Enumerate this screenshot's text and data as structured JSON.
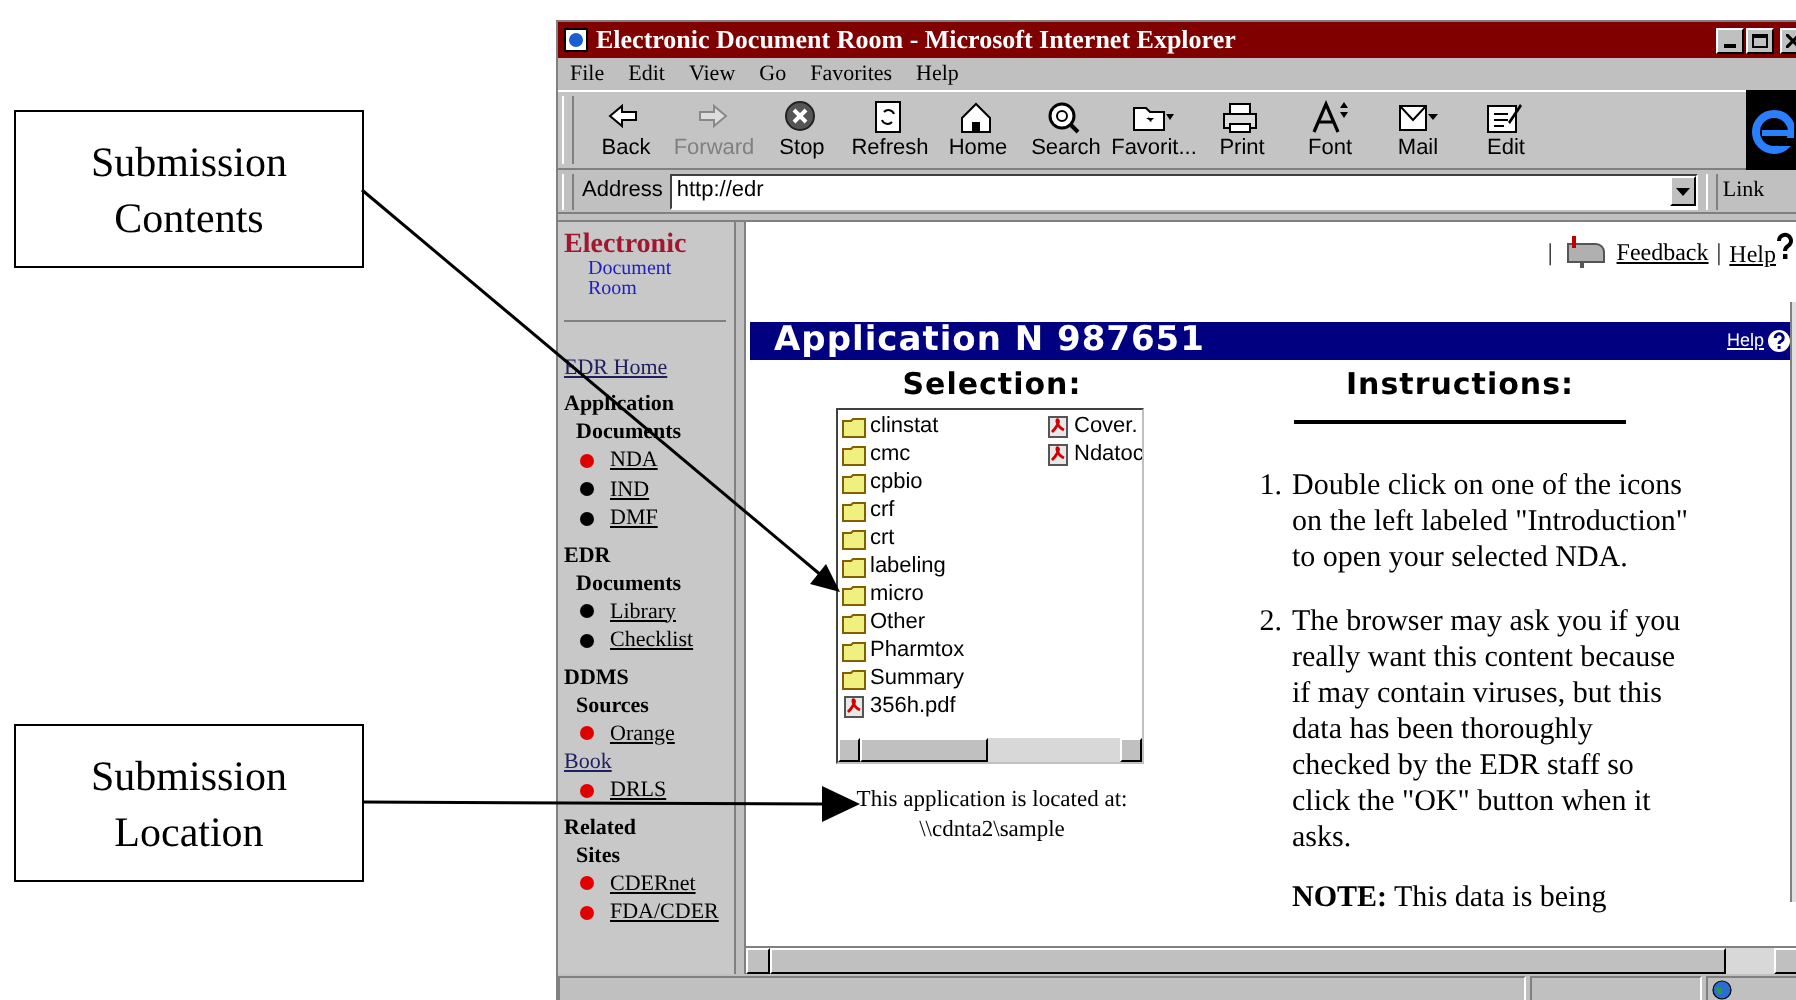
{
  "callouts": [
    {
      "lines": [
        "Submission",
        "Contents"
      ]
    },
    {
      "lines": [
        "Submission",
        "Location"
      ]
    }
  ],
  "window": {
    "title": "Electronic Document Room - Microsoft Internet Explorer"
  },
  "menu": [
    "File",
    "Edit",
    "View",
    "Go",
    "Favorites",
    "Help"
  ],
  "toolbar": [
    {
      "label": "Back",
      "disabled": false
    },
    {
      "label": "Forward",
      "disabled": true
    },
    {
      "label": "Stop",
      "disabled": false
    },
    {
      "label": "Refresh",
      "disabled": false
    },
    {
      "label": "Home",
      "disabled": false
    },
    {
      "label": "Search",
      "disabled": false
    },
    {
      "label": "Favorit...",
      "disabled": false
    },
    {
      "label": "Print",
      "disabled": false
    },
    {
      "label": "Font",
      "disabled": false
    },
    {
      "label": "Mail",
      "disabled": false
    },
    {
      "label": "Edit",
      "disabled": false
    }
  ],
  "address": {
    "label": "Address",
    "value": "http://edr"
  },
  "links_label": "Link",
  "sidebar": {
    "logo": [
      "Electronic",
      "Document",
      "Room"
    ],
    "items": [
      {
        "kind": "link",
        "text": "EDR Home"
      },
      {
        "kind": "heading",
        "text": "Application"
      },
      {
        "kind": "subheading",
        "text": "Documents"
      },
      {
        "kind": "bullet",
        "text": "NDA",
        "color": "#e00000"
      },
      {
        "kind": "bullet",
        "text": "IND",
        "color": "#000000"
      },
      {
        "kind": "bullet",
        "text": "DMF",
        "color": "#000000"
      },
      {
        "kind": "heading",
        "text": "EDR"
      },
      {
        "kind": "subheading",
        "text": "Documents"
      },
      {
        "kind": "bullet",
        "text": "Library",
        "color": "#000000"
      },
      {
        "kind": "bullet",
        "text": "Checklist",
        "color": "#000000"
      },
      {
        "kind": "heading",
        "text": "DDMS"
      },
      {
        "kind": "subheading",
        "text": "Sources"
      },
      {
        "kind": "bullet",
        "text": "Orange",
        "color": "#e00000"
      },
      {
        "kind": "link",
        "text": "Book"
      },
      {
        "kind": "bullet",
        "text": "DRLS",
        "color": "#e00000"
      },
      {
        "kind": "heading",
        "text": "Related"
      },
      {
        "kind": "subheading",
        "text": "Sites"
      },
      {
        "kind": "bullet",
        "text": "CDERnet",
        "color": "#e00000"
      },
      {
        "kind": "bullet",
        "text": "FDA/CDER",
        "color": "#e00000"
      }
    ]
  },
  "header": {
    "separator_1": "|",
    "feedback": "Feedback",
    "separator_2": "|",
    "help": "Help"
  },
  "panel": {
    "title": "Application N 987651",
    "help": "Help",
    "selection": {
      "heading": "Selection:",
      "files": [
        {
          "kind": "folder",
          "name": "clinstat"
        },
        {
          "kind": "folder",
          "name": "cmc"
        },
        {
          "kind": "folder",
          "name": "cpbio"
        },
        {
          "kind": "folder",
          "name": "crf"
        },
        {
          "kind": "folder",
          "name": "crt"
        },
        {
          "kind": "folder",
          "name": "labeling"
        },
        {
          "kind": "folder",
          "name": "micro"
        },
        {
          "kind": "folder",
          "name": "Other"
        },
        {
          "kind": "folder",
          "name": "Pharmtox"
        },
        {
          "kind": "folder",
          "name": "Summary"
        },
        {
          "kind": "pdf",
          "name": "356h.pdf"
        },
        {
          "kind": "pdf",
          "name": "Cover."
        },
        {
          "kind": "pdf",
          "name": "Ndatoc"
        }
      ],
      "location": [
        "This application is located at:",
        "\\\\cdnta2\\sample"
      ]
    },
    "instructions": {
      "heading": "Instructions:",
      "steps": [
        {
          "number": "1.",
          "text": "Double click on one of the icons on the left labeled \"Introduction\" to open your selected NDA."
        },
        {
          "number": "2.",
          "text": "The browser may ask you if you really want this content because if may contain viruses, but this data has been thoroughly checked by the EDR staff so click the \"OK\" button when it asks."
        }
      ],
      "note": "**NOTE:** This data is being"
    }
  }
}
